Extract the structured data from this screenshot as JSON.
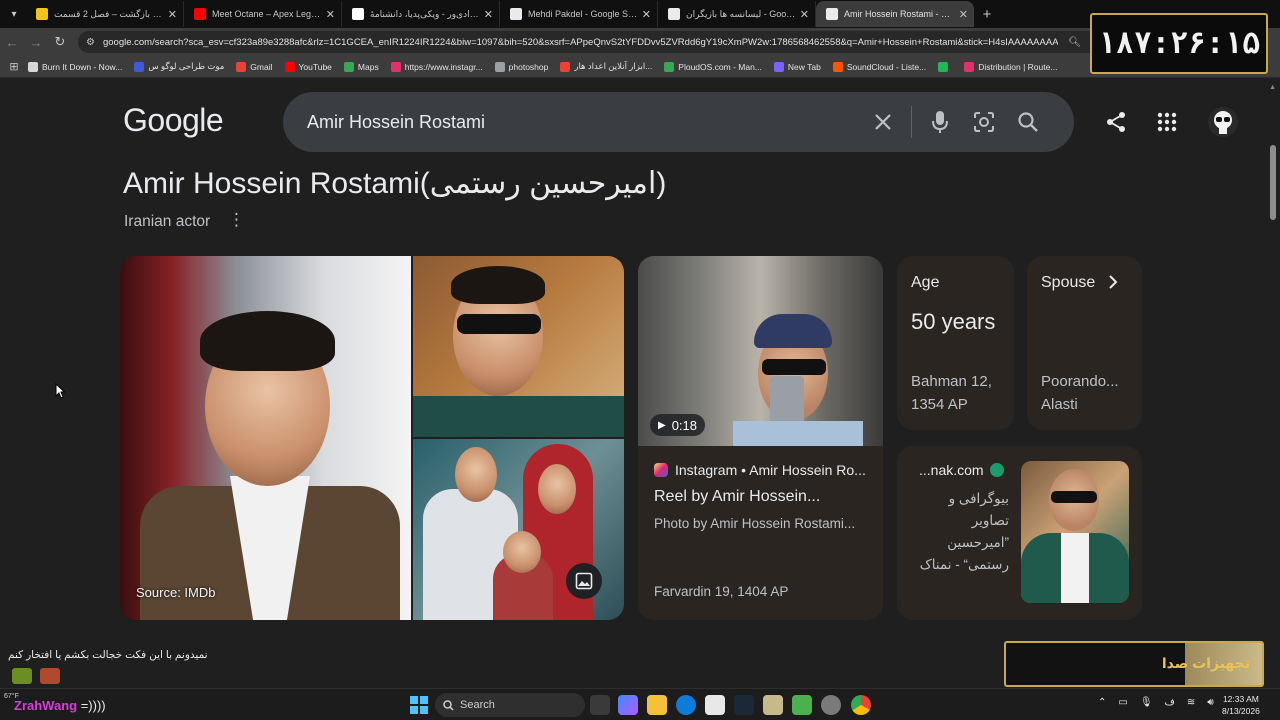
{
  "browser": {
    "tabs": [
      {
        "title": "زخم کاری بازگشت – فصل 2 قسمت",
        "favicon_color": "#f0c419",
        "active": false
      },
      {
        "title": "Meet Octane – Apex Legends Ch",
        "favicon_color": "#ff0000",
        "active": false
      },
      {
        "title": "رعنا آزادی‌ور - ویکی‌پدیا، دانشنامهٔ",
        "favicon_color": "#ffffff",
        "active": false
      },
      {
        "title": "Mehdi Pakdel - Google Search",
        "favicon_color": "#e8eaed",
        "active": false
      },
      {
        "title": "لیسانسه ها بازیگران - Google Search",
        "favicon_color": "#e8eaed",
        "active": false
      },
      {
        "title": "Amir Hossein Rostami - Google",
        "favicon_color": "#e8eaed",
        "active": true
      }
    ],
    "new_tab_label": "+",
    "url": "google.com/search?sca_esv=cf323a89e3288afc&rlz=1C1GCEA_enIR1224IR1224&biw=1097&bih=520&sxsrf=APpeQnvS2tYFDDvv5ZVRdd6gY19cXmPW2w:1786568462558&q=Amir+Hossein+Rostami&stick=H4sIAAAAAAAAAON...",
    "bookmarks": [
      {
        "label": "Burn It Down - Now...",
        "color": "#d8d8d8"
      },
      {
        "label": "موت طراحی لوگو س",
        "color": "#3b5bdb"
      },
      {
        "label": "Gmail",
        "color": "#ea4335"
      },
      {
        "label": "YouTube",
        "color": "#ff0000"
      },
      {
        "label": "Maps",
        "color": "#34a853"
      },
      {
        "label": "https://www.instagr...",
        "color": "#e1306c"
      },
      {
        "label": "photoshop",
        "color": "#9aa0a6"
      },
      {
        "label": "ابزار آنلاین اعداد هار...",
        "color": "#ea4335"
      },
      {
        "label": "PloudOS.com - Man...",
        "color": "#34a853"
      },
      {
        "label": "New Tab",
        "color": "#7b61ff"
      },
      {
        "label": "SoundCloud - Liste...",
        "color": "#ff5500"
      },
      {
        "label": "",
        "color": "#1db954"
      },
      {
        "label": "Distribution | Route...",
        "color": "#e1306c"
      }
    ]
  },
  "overlay": {
    "clock": "۱۸۷:۲۶:۱۵",
    "chat_message": "نمیدونم با این فکت خجالت بکشم یا افتخار کنم",
    "chat_user": "ZrahWang",
    "chat_user_message": " =))))",
    "donation_label": "تجهیزات صدا",
    "weather": "67°F"
  },
  "google": {
    "logo": "Google",
    "query": "Amir Hossein Rostami",
    "kp_title": "Amir Hossein Rostami(امیرحسین رستمی)",
    "kp_subtitle": "Iranian actor",
    "image_source": "Source: IMDb",
    "reel": {
      "duration": "0:18",
      "source": "Instagram • Amir Hossein Ro...",
      "title": "Reel by Amir Hossein...",
      "description": "Photo by Amir Hossein Rostami...",
      "date": "Farvardin 19, 1404 AP"
    },
    "age": {
      "label": "Age",
      "value": "50 years",
      "date": "Bahman 12, 1354 AP"
    },
    "spouse": {
      "label": "Spouse",
      "name": "Poorando... Alasti"
    },
    "namnak": {
      "site": "...nak.com",
      "text": "بیوگرافی و تصاویر ”امیرحسین رستمی“ - نمناک"
    }
  },
  "taskbar": {
    "search_label": "Search",
    "time": "12:33 AM",
    "date": "8/13/2026"
  }
}
